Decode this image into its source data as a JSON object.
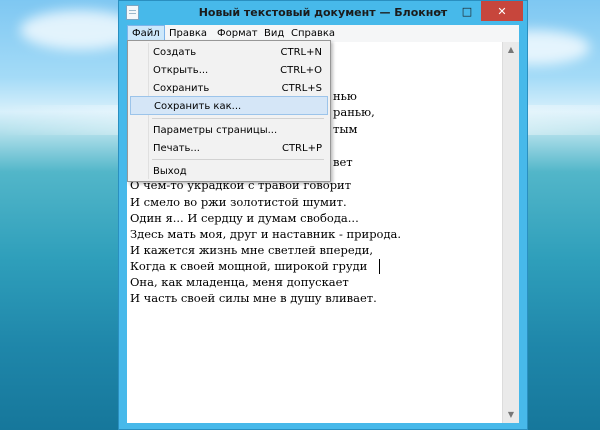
{
  "window": {
    "title": "Новый текстовый документ — Блокнот"
  },
  "caption": {
    "minimize": "—",
    "maximize": "□",
    "close": "✕"
  },
  "menubar": [
    "Файл",
    "Правка",
    "Формат",
    "Вид",
    "Справка"
  ],
  "file_menu": {
    "items": [
      {
        "label": "Создать",
        "shortcut": "CTRL+N"
      },
      {
        "label": "Открыть...",
        "shortcut": "CTRL+O"
      },
      {
        "label": "Сохранить",
        "shortcut": "CTRL+S"
      },
      {
        "label": "Сохранить как...",
        "shortcut": ""
      },
      {
        "label": "Параметры страницы...",
        "shortcut": ""
      },
      {
        "label": "Печать...",
        "shortcut": "CTRL+P"
      },
      {
        "label": "Выход",
        "shortcut": ""
      }
    ]
  },
  "editor": {
    "partial_right": [
      "нью",
      "ранью,",
      "тым",
      "вет"
    ],
    "lines": [
      "О чем-то украдкой с травой говорит",
      "И смело во ржи золотистой шумит.",
      "Один я... И сердцу и думам свобода...",
      "Здесь мать моя, друг и наставник - природа.",
      "И кажется жизнь мне светлей впереди,",
      "Когда к своей мощной, широкой груди",
      "Она, как младенца, меня допускает",
      "И часть своей силы мне в душу вливает."
    ]
  },
  "scrollbar": {
    "up": "▲",
    "down": "▼"
  }
}
